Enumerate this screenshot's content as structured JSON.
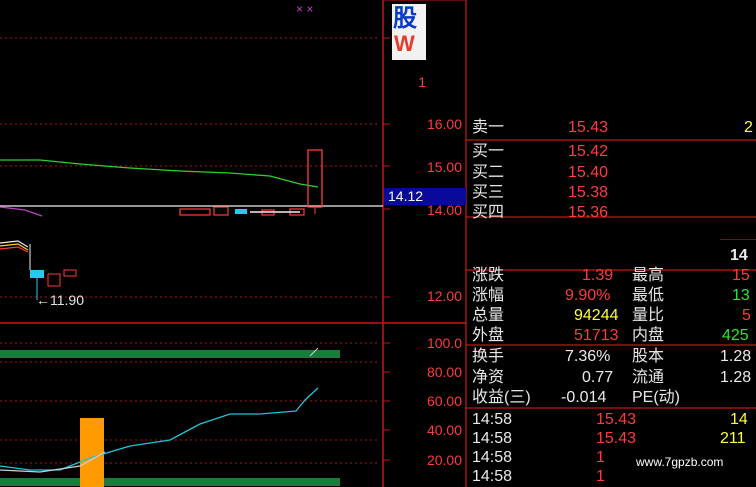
{
  "colors": {
    "bg": "#000000",
    "grid_red": "#c01818",
    "axis_red": "#ff3b3b",
    "green_line": "#2ed12e",
    "band_green": "#1d7a3a",
    "cyan": "#20c4d8",
    "orange": "#ff9a00",
    "blue_box": "#0a0a9a"
  },
  "logo": {
    "glyph_top": "股",
    "glyph_bottom": "W"
  },
  "marks": {
    "top_marks": "× ×"
  },
  "price_axis": [
    "1",
    "16.00",
    "15.00",
    "14.00",
    "12.00"
  ],
  "current_price_box": "14.12",
  "low_marker": "←11.90",
  "indicator_axis": [
    "100.0",
    "80.00",
    "60.00",
    "40.00",
    "20.00"
  ],
  "orderbook": {
    "sell1": {
      "label": "卖一",
      "price": "15.43",
      "vol": "2"
    },
    "buy1": {
      "label": "买一",
      "price": "15.42"
    },
    "buy2": {
      "label": "买二",
      "price": "15.40"
    },
    "buy3": {
      "label": "买三",
      "price": "15.38"
    },
    "buy4": {
      "label": "买四",
      "price": "15.36"
    }
  },
  "right_stub": "14",
  "stats": {
    "change": {
      "label": "涨跌",
      "value": "1.39",
      "label2": "最高",
      "value2": "15"
    },
    "pct": {
      "label": "涨幅",
      "value": "9.90%",
      "label2": "最低",
      "value2": "13"
    },
    "volume": {
      "label": "总量",
      "value": "94244",
      "label2": "量比",
      "value2": "5"
    },
    "outer": {
      "label": "外盘",
      "value": "51713",
      "label2": "内盘",
      "value2": "425"
    },
    "turnover": {
      "label": "换手",
      "value": "7.36%",
      "label2": "股本",
      "value2": "1.28"
    },
    "nav": {
      "label": "净资",
      "value": "0.77",
      "label2": "流通",
      "value2": "1.28"
    },
    "eps": {
      "label": "收益(三)",
      "value": "-0.014",
      "label2": "PE(动)",
      "value2": ""
    }
  },
  "ticks": [
    {
      "time": "14:58",
      "price": "15.43",
      "vol": "14"
    },
    {
      "time": "14:58",
      "price": "15.43",
      "vol": "211"
    },
    {
      "time": "14:58",
      "price": "1",
      "vol": ""
    },
    {
      "time": "14:58",
      "price": "1",
      "vol": ""
    }
  ],
  "watermark": "www.7gpzb.com"
}
